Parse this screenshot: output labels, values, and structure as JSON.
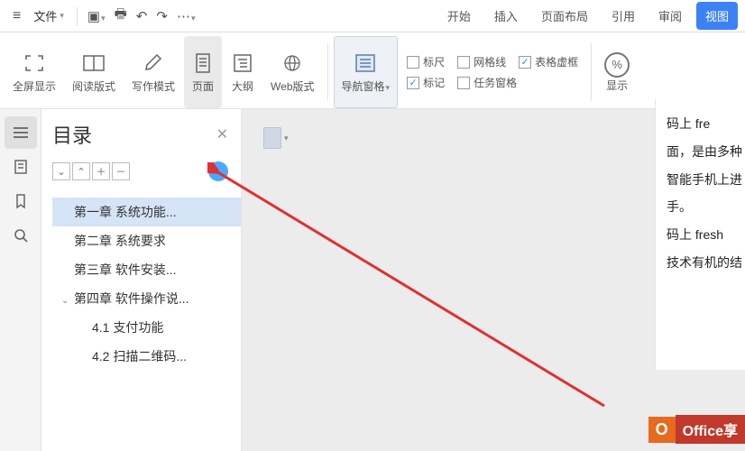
{
  "menubar": {
    "file_label": "文件",
    "tabs": [
      "开始",
      "插入",
      "页面布局",
      "引用",
      "审阅",
      "视图"
    ],
    "active_tab": 5
  },
  "ribbon": {
    "fullscreen": "全屏显示",
    "reading": "阅读版式",
    "writing": "写作模式",
    "page": "页面",
    "outline": "大纲",
    "web": "Web版式",
    "nav_pane": "导航窗格",
    "chk_ruler": "标尺",
    "chk_grid": "网格线",
    "chk_table_virtual": "表格虚框",
    "chk_mark": "标记",
    "chk_taskpane": "任务窗格",
    "display": "显示"
  },
  "nav": {
    "title": "目录",
    "items": [
      {
        "level": 1,
        "label": "第一章   系统功能...",
        "selected": true
      },
      {
        "level": 1,
        "label": "第二章   系统要求"
      },
      {
        "level": 1,
        "label": "第三章   软件安装..."
      },
      {
        "level": 1,
        "label": "第四章  软件操作说...",
        "expanded": true,
        "hasChildren": true
      },
      {
        "level": 2,
        "label": "4.1  支付功能"
      },
      {
        "level": 2,
        "label": "4.2   扫描二维码..."
      }
    ]
  },
  "doc_lines": [
    "码上 fre",
    "面，是由多种",
    "智能手机上进",
    "手。",
    "",
    "码上 fresh",
    "技术有机的结"
  ],
  "watermark": {
    "left": "O",
    "right": "Office享"
  }
}
